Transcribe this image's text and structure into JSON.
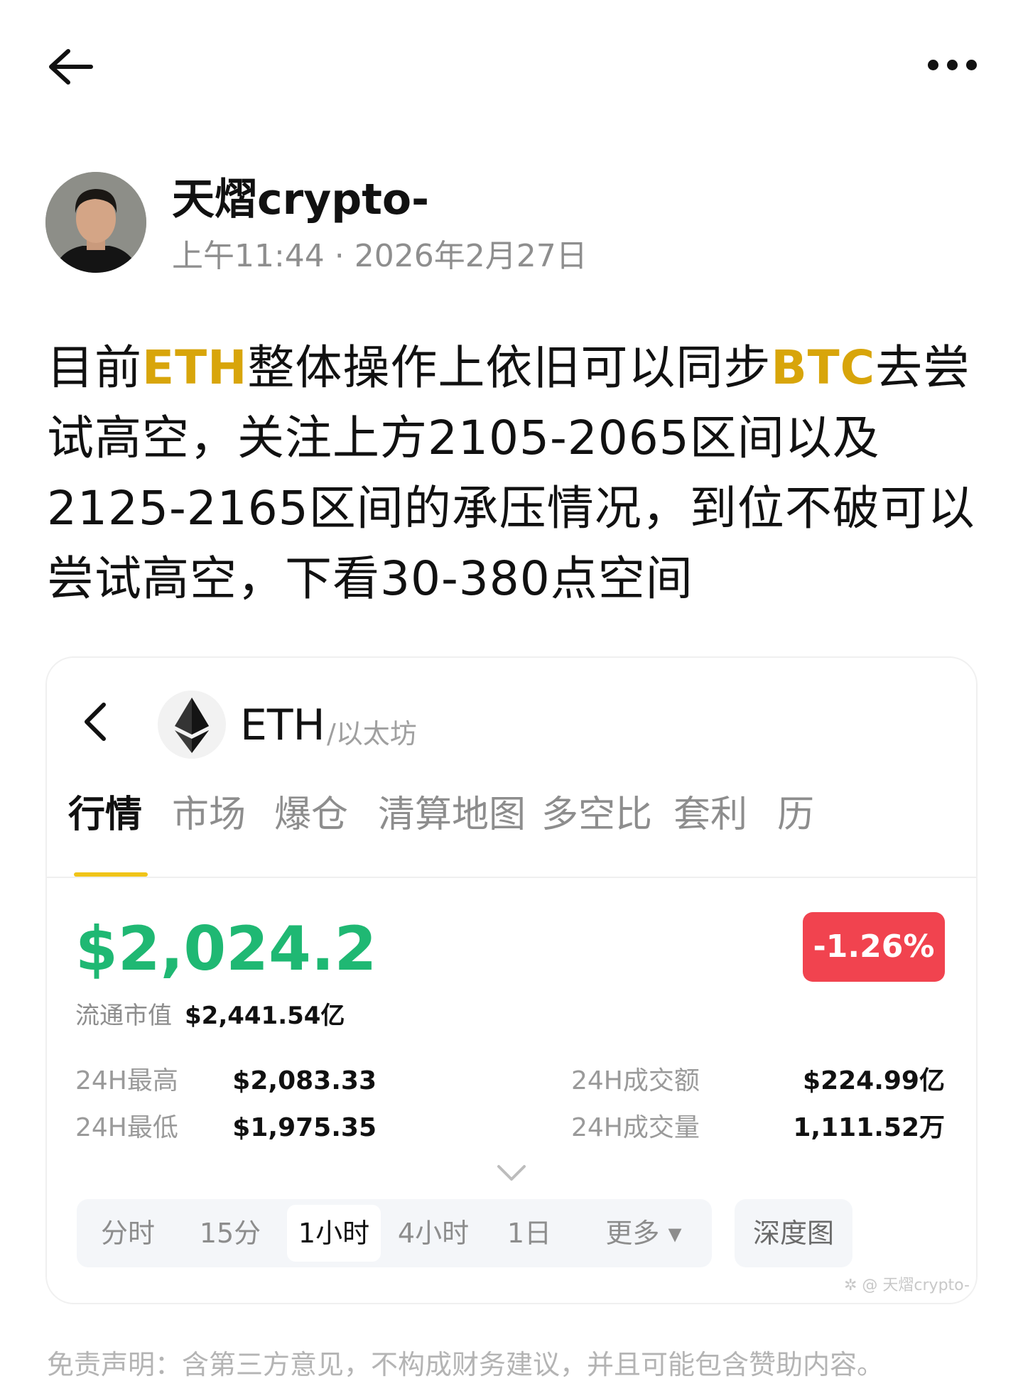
{
  "header": {
    "back_icon": "arrow-left-icon",
    "more_icon": "more-horizontal-icon"
  },
  "author": {
    "name": "天熠crypto-",
    "time": "上午11:44 · 2026年2月27日"
  },
  "post": {
    "segments": [
      {
        "text": "目前",
        "highlight": false
      },
      {
        "text": "ETH",
        "highlight": true
      },
      {
        "text": "整体操作上依旧可以同步",
        "highlight": false
      },
      {
        "text": "BTC",
        "highlight": true
      },
      {
        "text": "去尝试高空，关注上方2105-2065区间以及2125-2165区间的承压情况，到位不破可以尝试高空，下看30-380点空间",
        "highlight": false
      }
    ],
    "highlight_color": "#d8a50a"
  },
  "card": {
    "coin_name": "ETH",
    "coin_sub": "/以太坊",
    "tabs": [
      "行情",
      "市场",
      "爆仓",
      "清算地图",
      "多空比",
      "套利",
      "历"
    ],
    "active_tab": 0,
    "price": "$2,024.2",
    "price_color": "#1fb873",
    "change": "-1.26%",
    "change_color": "#f1434f",
    "market_cap_label": "流通市值",
    "market_cap_value": "$2,441.54亿",
    "stats": [
      {
        "label": "24H最高",
        "value": "$2,083.33"
      },
      {
        "label": "24H成交额",
        "value": "$224.99亿"
      },
      {
        "label": "24H最低",
        "value": "$1,975.35"
      },
      {
        "label": "24H成交量",
        "value": "1,111.52万"
      }
    ],
    "intervals": [
      "分时",
      "15分",
      "1小时",
      "4小时",
      "1日",
      "更多 ▾"
    ],
    "active_interval": 2,
    "depth_label": "深度图",
    "watermark": "✲ @ 天熠crypto-"
  },
  "disclaimer": "免责声明：含第三方意见，不构成财务建议，并且可能包含赞助内容。"
}
